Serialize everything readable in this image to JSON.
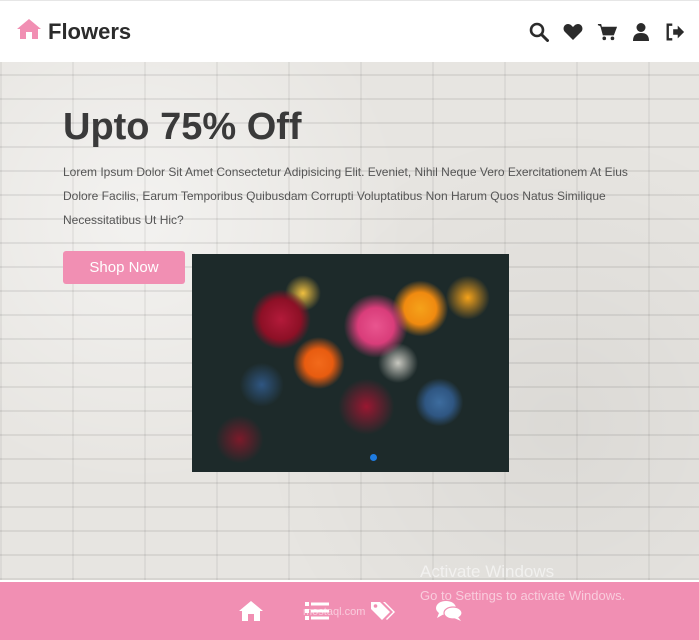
{
  "header": {
    "brand_name": "Flowers",
    "icons": [
      "home-icon",
      "search-icon",
      "heart-icon",
      "cart-icon",
      "user-icon",
      "sign-out-icon"
    ]
  },
  "hero": {
    "title": "Upto 75% Off",
    "text": "Lorem Ipsum Dolor Sit Amet Consectetur Adipisicing Elit. Eveniet, Nihil Neque Vero Exercitationem At Eius Dolore Facilis, Earum Temporibus Quibusdam Corrupti Voluptatibus Non Harum Quos Natus Similique Necessitatibus Ut Hic?",
    "button_label": "Shop Now",
    "slider_active_index": 1
  },
  "footer": {
    "icons": [
      "home-icon",
      "list-icon",
      "tags-icon",
      "comments-icon"
    ]
  },
  "overlay": {
    "activate_title": "Activate Windows",
    "activate_sub": "Go to Settings to activate Windows.",
    "watermark": "mostaql.com"
  },
  "colors": {
    "accent": "#f18fb3",
    "text_dark": "#2b2b2b",
    "slider_dot": "#1e7be0"
  }
}
